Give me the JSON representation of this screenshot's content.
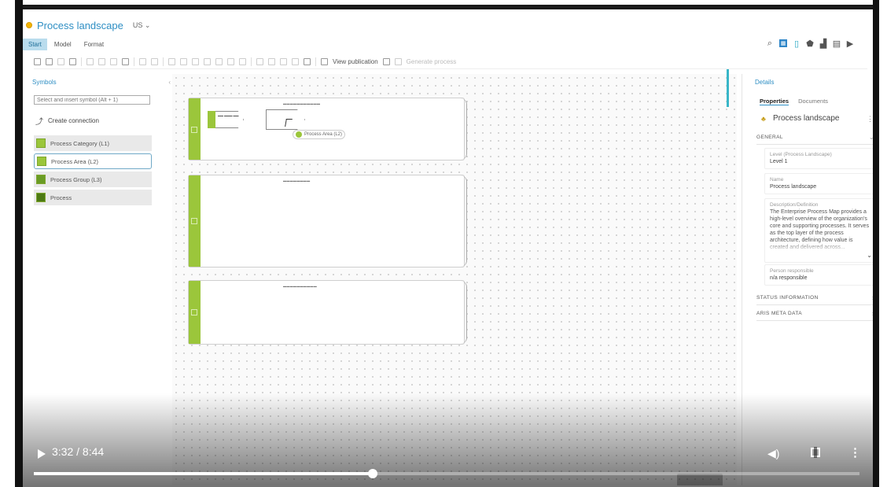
{
  "app": {
    "title": "Process landscape",
    "language": "US ⌄"
  },
  "menu": {
    "tabs": [
      "Start",
      "Model",
      "Format"
    ],
    "active_index": 0
  },
  "toolbar": {
    "view_publication": "View publication",
    "generate_process": "Generate process"
  },
  "symbols_panel": {
    "header": "Symbols",
    "collapse_icon": "‹",
    "search_placeholder": "Select and insert symbol (Alt + 1)",
    "create_connection": "Create connection",
    "items": [
      {
        "label": "Process Category (L1)",
        "icon": "process-category-icon"
      },
      {
        "label": "Process Area (L2)",
        "icon": "process-area-icon",
        "selected": true
      },
      {
        "label": "Process Group (L3)",
        "icon": "process-group-icon"
      },
      {
        "label": "Process",
        "icon": "process-icon"
      }
    ]
  },
  "canvas": {
    "drag_label": "Process Area (L2)"
  },
  "details_panel": {
    "header": "Details",
    "tabs": [
      "Properties",
      "Documents"
    ],
    "object_name": "Process landscape",
    "sections": {
      "general": "GENERAL",
      "status": "STATUS INFORMATION",
      "aris_meta": "ARIS META DATA"
    },
    "attributes": {
      "level_label": "Level (Process Landscape)",
      "level_value": "Level 1",
      "name_label": "Name",
      "name_value": "Process landscape",
      "description_label": "Description/Definition",
      "description_value": "The Enterprise Process Map provides a high-level overview of the organization's core and supporting processes. It serves as the top layer of the process architecture, defining how value is created and delivered across...",
      "responsible_label": "Person responsible",
      "responsible_value": "n/a responsible"
    }
  },
  "video": {
    "time": "3:32 / 8:44",
    "progress": 0.41
  },
  "colors": {
    "accent": "#2f8fc4",
    "green": "#9bc63b"
  }
}
